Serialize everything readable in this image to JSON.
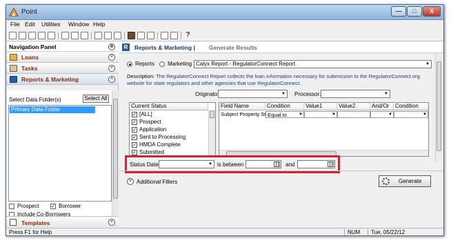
{
  "window": {
    "title": "Point",
    "minimize": "—",
    "maximize": "□",
    "close": "X"
  },
  "menu": [
    "File",
    "Edit",
    "Utilities",
    "Window",
    "Help"
  ],
  "toolbar": {
    "help_glyph": "?"
  },
  "nav": {
    "title": "Navigation Panel",
    "close_glyph": "⊗",
    "sections": [
      {
        "label": "Loans",
        "icon": "loans-icon"
      },
      {
        "label": "Tasks",
        "icon": "tasks-icon"
      },
      {
        "label": "Reports & Marketing",
        "icon": "reports-icon"
      }
    ],
    "select_folder_label": "Select Data Folder(s)",
    "select_all": "Select All",
    "folders": [
      "Primary Data Folder"
    ],
    "prospect": "Prospect",
    "borrower": "Borrower",
    "include_coborrowers": "Include Co-Borrowers",
    "templates": "Templates",
    "chevron_up": "˄",
    "chevron_down": "˅"
  },
  "main": {
    "badge": "R",
    "tab_active": "Reports & Marketing |",
    "tab_other": "Generate Results",
    "radio_reports": "Reports",
    "radio_marketing": "Marketing",
    "report_select": "Calyx Report - RegulatorConnect Report",
    "description_label": "Description:",
    "description": "The RegulatorConnect Report collects the loan information necessary for submission to the RegulatorConnect.org website for state regulators and other agencies that use RegulatorConnect.",
    "originator_label": "Originator:",
    "processor_label": "Processor:",
    "status_header": "Current Status",
    "statuses": [
      {
        "label": "[ALL]",
        "checked": true
      },
      {
        "label": "Prospect",
        "checked": true
      },
      {
        "label": "Application",
        "checked": true
      },
      {
        "label": "Sent to Processing",
        "checked": true
      },
      {
        "label": "HMDA Complete",
        "checked": true
      },
      {
        "label": "Submitted",
        "checked": true
      }
    ],
    "grid_headers": [
      "Field Name",
      "Condition",
      "Value1",
      "Value2",
      "And/Or",
      "Condition"
    ],
    "grid_row": {
      "field": "Subject Property Sta",
      "condition": "Equal to"
    },
    "status_date_label": "Status Date:",
    "is_between": "is between",
    "and": "and",
    "additional_filters": "Additional Filters",
    "generate": "Generate"
  },
  "status_bar": {
    "help": "Press F1 for Help",
    "num": "NUM",
    "date": "Tue, 05/22/12"
  }
}
